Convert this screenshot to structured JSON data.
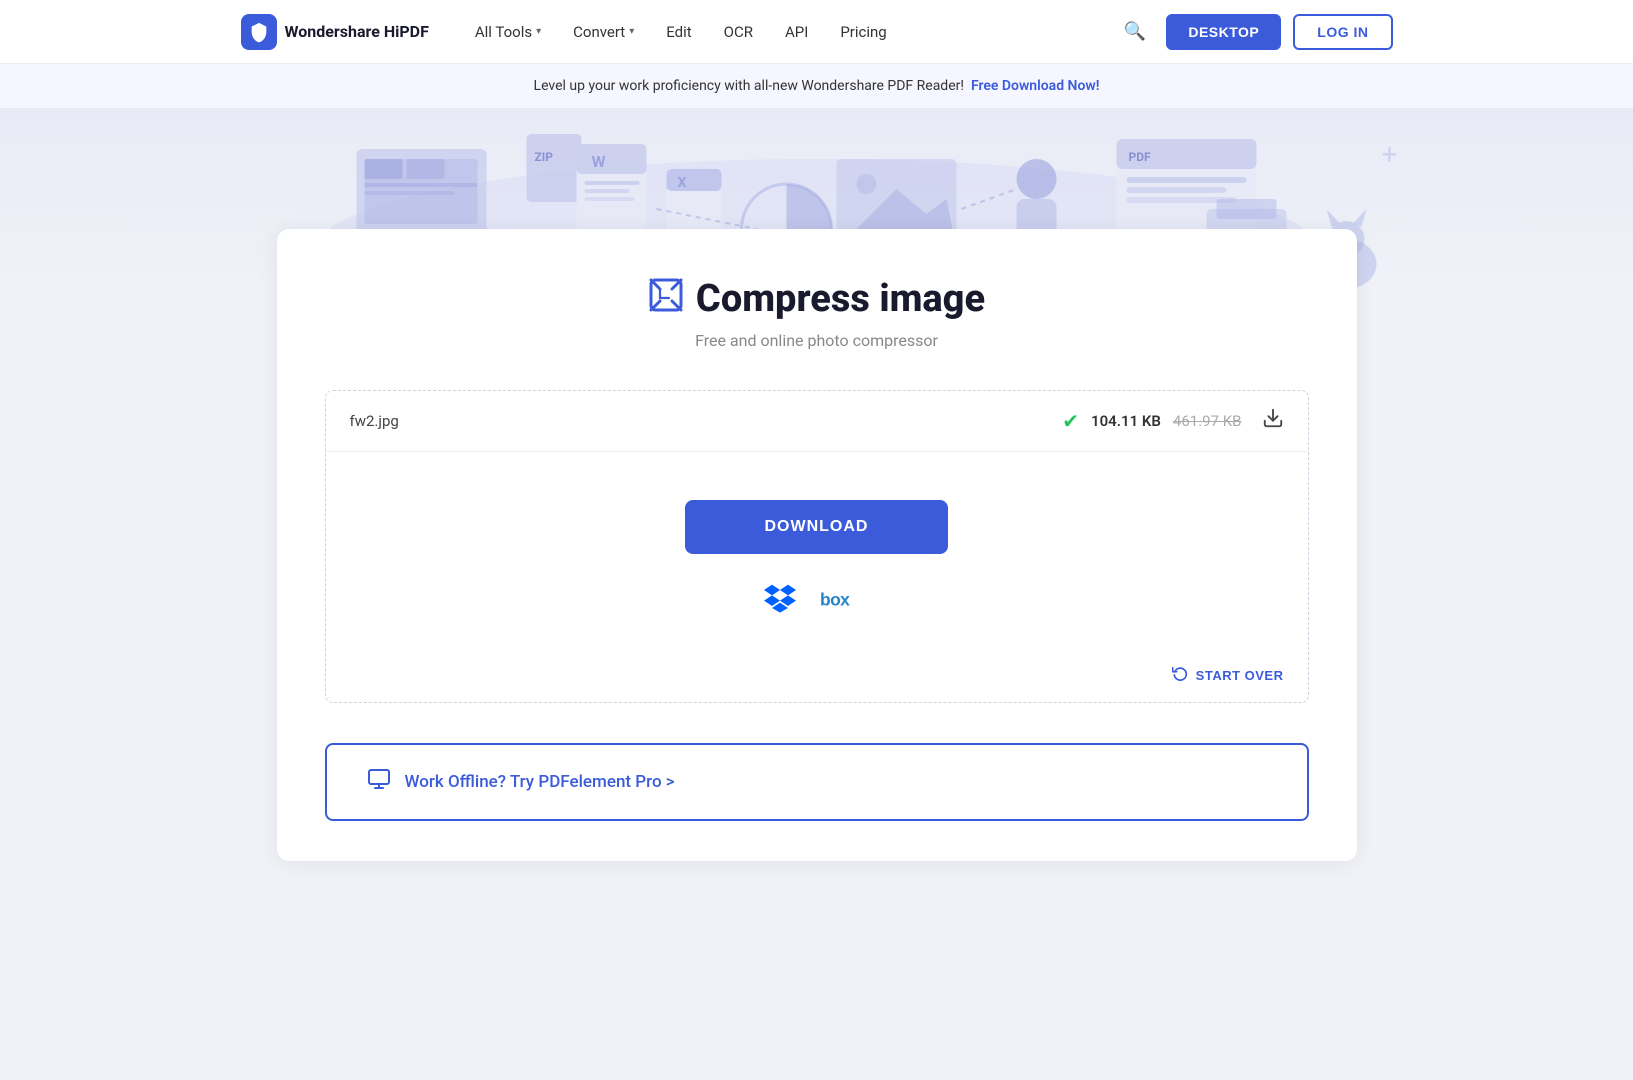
{
  "navbar": {
    "logo_text": "Wondershare HiPDF",
    "nav_items": [
      {
        "label": "All Tools",
        "has_chevron": true
      },
      {
        "label": "Convert",
        "has_chevron": true
      },
      {
        "label": "Edit",
        "has_chevron": false
      },
      {
        "label": "OCR",
        "has_chevron": false
      },
      {
        "label": "API",
        "has_chevron": false
      },
      {
        "label": "Pricing",
        "has_chevron": false
      }
    ],
    "btn_desktop": "DESKTOP",
    "btn_login": "LOG IN"
  },
  "banner": {
    "text": "Level up your work proficiency with all-new Wondershare PDF Reader!",
    "link_text": "Free Download Now!"
  },
  "tool": {
    "title": "Compress image",
    "subtitle": "Free and online photo compressor",
    "file_name": "fw2.jpg",
    "file_size_new": "104.11 KB",
    "file_size_old": "461.97 KB",
    "btn_download": "DOWNLOAD",
    "btn_start_over": "START OVER",
    "offline_banner_text": "Work Offline? Try PDFelement Pro >"
  },
  "colors": {
    "brand_blue": "#3b5bdb",
    "success_green": "#22c55e",
    "dropbox_blue": "#0061ff",
    "box_blue": "#2486c8"
  }
}
